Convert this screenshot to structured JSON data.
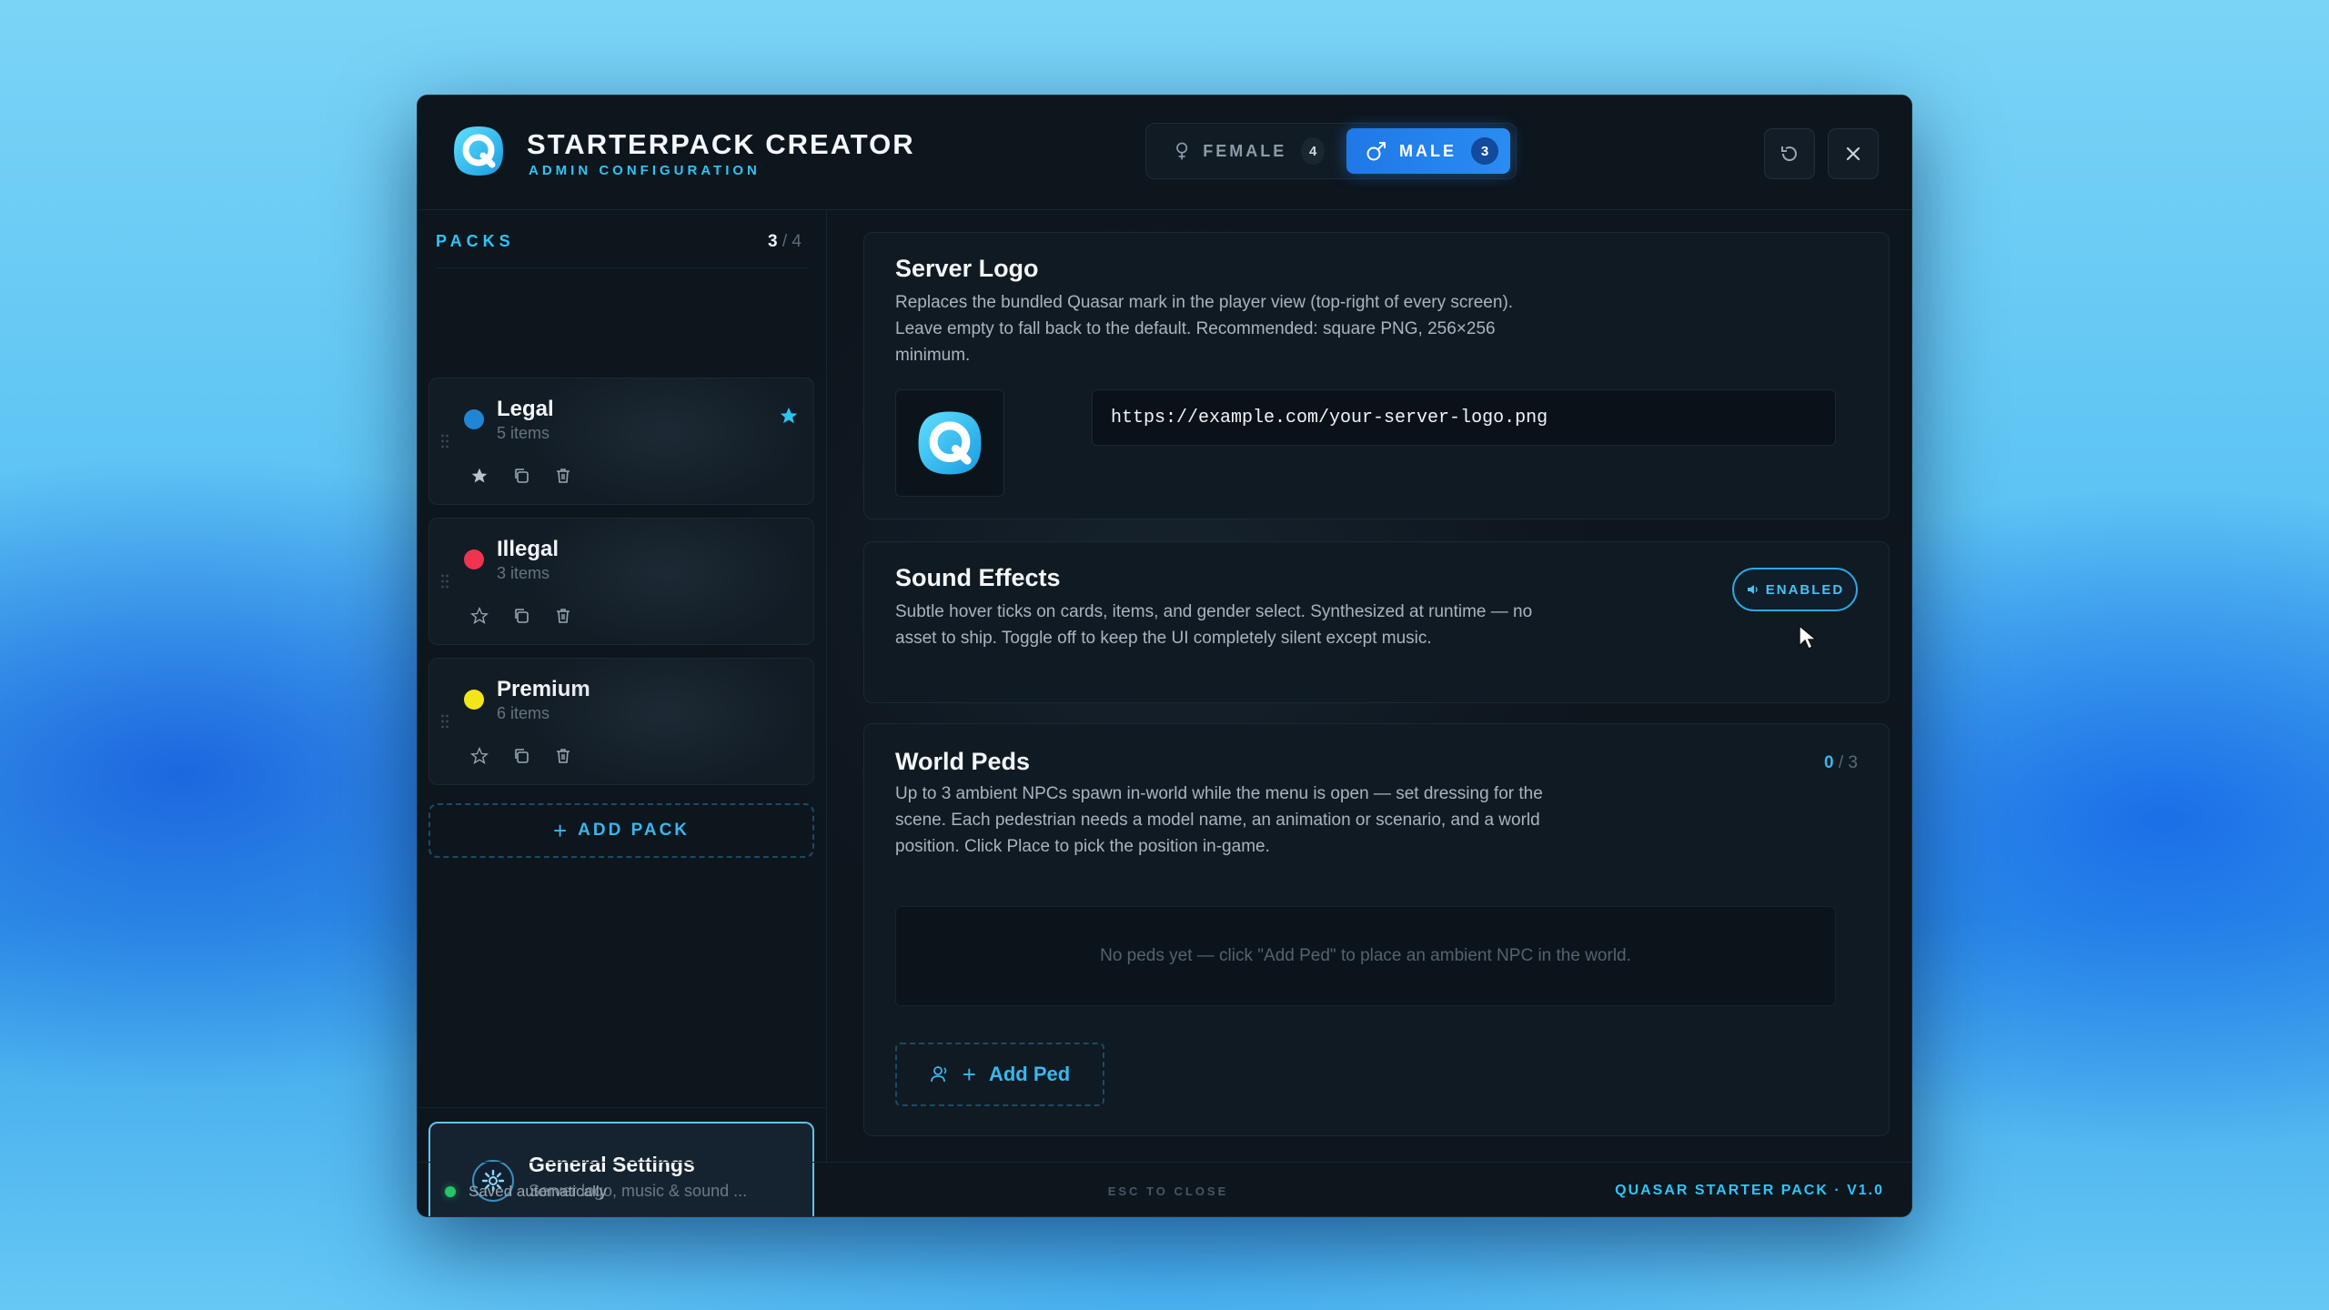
{
  "app": {
    "title": "STARTERPACK CREATOR",
    "subtitle": "ADMIN CONFIGURATION",
    "accent_color": "#2ec5f5"
  },
  "gender": {
    "female": {
      "label": "FEMALE",
      "count": "4",
      "icon": "female-icon"
    },
    "male": {
      "label": "MALE",
      "count": "3",
      "icon": "male-icon",
      "selected": true
    }
  },
  "header_buttons": {
    "refresh_icon": "refresh-icon",
    "close_icon": "close-icon"
  },
  "packs": {
    "label": "PACKS",
    "current": "3",
    "separator": "/",
    "max": "4",
    "items": [
      {
        "name": "Legal",
        "subtitle": "5 items",
        "dot_color": "#1f86d6",
        "favorite": true
      },
      {
        "name": "Illegal",
        "subtitle": "3 items",
        "dot_color": "#f0334f",
        "favorite": false
      },
      {
        "name": "Premium",
        "subtitle": "6 items",
        "dot_color": "#f3e51b",
        "favorite": false
      }
    ],
    "add_label": "ADD PACK"
  },
  "general_settings": {
    "title": "General Settings",
    "subtitle": "Server logo, music & sound ..."
  },
  "server_logo": {
    "title": "Server Logo",
    "description": "Replaces the bundled Quasar mark in the player view (top-right of every screen). Leave empty to fall back to the default. Recommended: square PNG, 256×256 minimum.",
    "url_value": "https://example.com/your-server-logo.png"
  },
  "sound_effects": {
    "title": "Sound Effects",
    "description": "Subtle hover ticks on cards, items, and gender select. Synthesized at runtime — no asset to ship. Toggle off to keep the UI completely silent except music.",
    "toggle_label": "ENABLED"
  },
  "world_peds": {
    "title": "World Peds",
    "current": "0",
    "separator": "/",
    "max": "3",
    "description": "Up to 3 ambient NPCs spawn in-world while the menu is open — set dressing for the scene. Each pedestrian needs a model name, an animation or scenario, and a world position. Click Place to pick the position in-game.",
    "empty_text": "No peds yet — click \"Add Ped\" to place an ambient NPC in the world.",
    "add_label": "Add Ped"
  },
  "footer": {
    "saved": "Saved automatically",
    "esc": "ESC TO CLOSE",
    "version": "QUASAR STARTER PACK · V1.0"
  }
}
